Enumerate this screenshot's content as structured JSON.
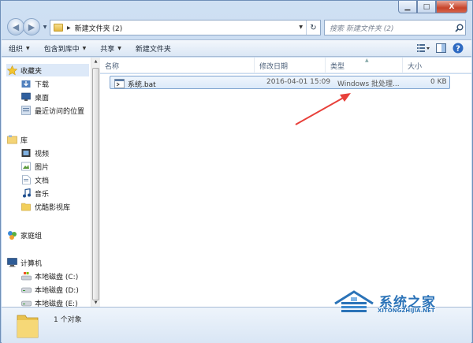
{
  "window": {
    "caption_buttons": [
      "minimize-icon",
      "maximize-icon",
      "close-icon"
    ],
    "close_label": "X"
  },
  "address": {
    "path": "新建文件夹 (2)",
    "search_placeholder": "搜索 新建文件夹 (2)"
  },
  "toolbar": {
    "organize": "组织",
    "include_library": "包含到库中",
    "share": "共享",
    "new_folder": "新建文件夹"
  },
  "nav": {
    "favorites": "收藏夹",
    "downloads": "下载",
    "desktop": "桌面",
    "recent": "最近访问的位置",
    "libraries": "库",
    "videos": "视频",
    "pictures": "图片",
    "documents": "文档",
    "music": "音乐",
    "youku": "优酷影视库",
    "homegroup": "家庭组",
    "computer": "计算机",
    "drive_c": "本地磁盘 (C:)",
    "drive_d": "本地磁盘 (D:)",
    "drive_e": "本地磁盘 (E:)"
  },
  "columns": {
    "name": "名称",
    "modified": "修改日期",
    "type": "类型",
    "size": "大小"
  },
  "files": [
    {
      "name": "系统.bat",
      "modified": "2016-04-01 15:09",
      "type": "Windows 批处理...",
      "size": "0 KB"
    }
  ],
  "details": {
    "count": "1 个对象"
  },
  "watermark": {
    "text": "系统之家",
    "url": "XITONGZHIJIA.NET"
  },
  "colors": {
    "arrow": "#e8403a",
    "selection": "#dbe9f9",
    "watermark": "#2b73b8"
  }
}
